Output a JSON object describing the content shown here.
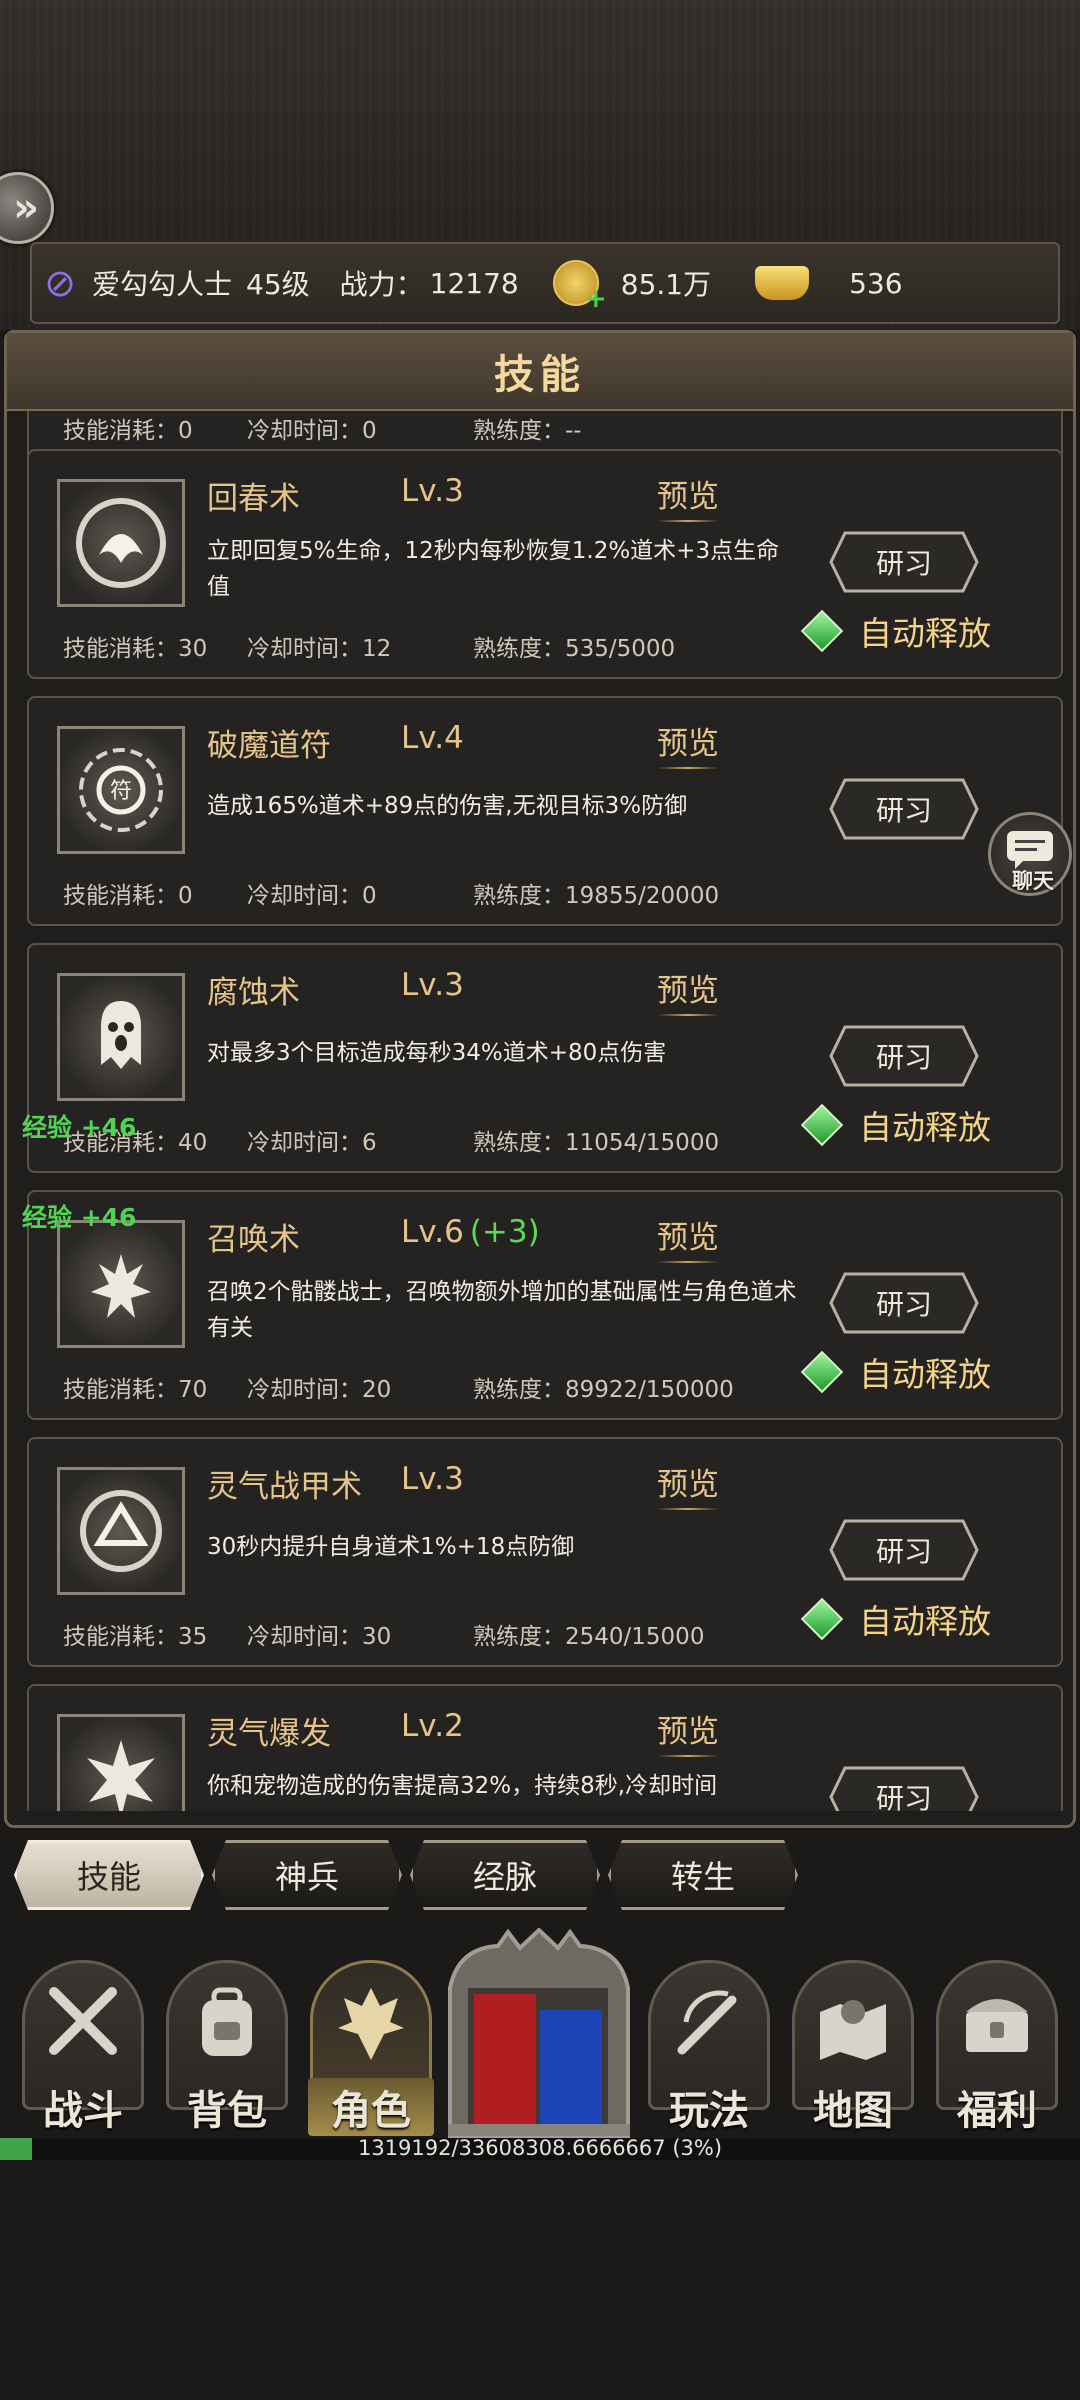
{
  "topbar": {
    "player_name": "爱勾勾人士",
    "level": "45级",
    "power_label": "战力：",
    "power_value": "12178",
    "money": "85.1万",
    "ingot": "536"
  },
  "panel": {
    "title": "技能"
  },
  "partial_top_stats": {
    "cost": "技能消耗：0",
    "cooldown": "冷却时间：0",
    "mastery": "熟练度：--"
  },
  "skills": [
    {
      "name": "回春术",
      "level": "Lv.3",
      "bonus": "",
      "preview": "预览",
      "desc": "立即回复5%生命，12秒内每秒恢复1.2%道术+3点生命值",
      "cost": "技能消耗：30",
      "cooldown": "冷却时间：12",
      "mastery": "熟练度：535/5000",
      "study": "研习",
      "auto": "自动释放"
    },
    {
      "name": "破魔道符",
      "level": "Lv.4",
      "bonus": "",
      "preview": "预览",
      "desc": "造成165%道术+89点的伤害,无视目标3%防御",
      "cost": "技能消耗：0",
      "cooldown": "冷却时间：0",
      "mastery": "熟练度：19855/20000",
      "study": "研习",
      "auto": ""
    },
    {
      "name": "腐蚀术",
      "level": "Lv.3",
      "bonus": "",
      "preview": "预览",
      "desc": "对最多3个目标造成每秒34%道术+80点伤害",
      "cost": "技能消耗：40",
      "cooldown": "冷却时间：6",
      "mastery": "熟练度：11054/15000",
      "study": "研习",
      "auto": "自动释放"
    },
    {
      "name": "召唤术",
      "level": "Lv.6",
      "bonus": "(+3)",
      "preview": "预览",
      "desc": "召唤2个骷髅战士，召唤物额外增加的基础属性与角色道术有关",
      "cost": "技能消耗：70",
      "cooldown": "冷却时间：20",
      "mastery": "熟练度：89922/150000",
      "study": "研习",
      "auto": "自动释放"
    },
    {
      "name": "灵气战甲术",
      "level": "Lv.3",
      "bonus": "",
      "preview": "预览",
      "desc": "30秒内提升自身道术1%+18点防御",
      "cost": "技能消耗：35",
      "cooldown": "冷却时间：30",
      "mastery": "熟练度：2540/15000",
      "study": "研习",
      "auto": "自动释放"
    },
    {
      "name": "灵气爆发",
      "level": "Lv.2",
      "bonus": "",
      "preview": "预览",
      "desc": "你和宠物造成的伤害提高32%，持续8秒,冷却时间",
      "cost": "",
      "cooldown": "",
      "mastery": "",
      "study": "研习",
      "auto": ""
    }
  ],
  "exp_popups": [
    "经验 +46",
    "经验 +46"
  ],
  "chat": {
    "label": "聊天"
  },
  "tabs": [
    "技能",
    "神兵",
    "经脉",
    "转生"
  ],
  "nav": [
    "战斗",
    "背包",
    "角色",
    "玩法",
    "地图",
    "福利"
  ],
  "progress": {
    "text": "1319192/33608308.6666667 (3%)",
    "fraction": 0.03
  },
  "colors": {
    "accent_gold": "#e4c48a",
    "exp_green": "#4fd454",
    "auto_diamond": "#1f9a2a"
  }
}
